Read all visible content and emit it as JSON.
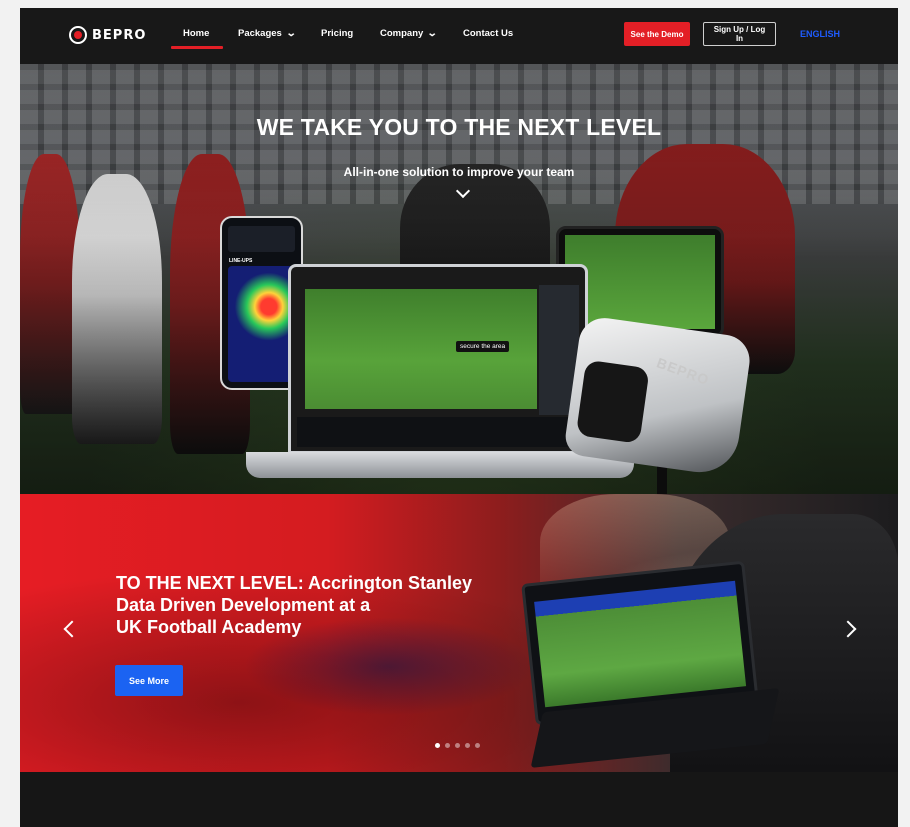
{
  "nav": {
    "logo_text": "BEPRO",
    "items": [
      {
        "label": "Home",
        "dropdown": false,
        "active": true
      },
      {
        "label": "Packages",
        "dropdown": true,
        "active": false
      },
      {
        "label": "Pricing",
        "dropdown": false,
        "active": false
      },
      {
        "label": "Company",
        "dropdown": true,
        "active": false
      },
      {
        "label": "Contact Us",
        "dropdown": false,
        "active": false
      }
    ],
    "demo_label": "See the Demo",
    "login_label": "Sign Up / Log In",
    "language": "ENGLISH"
  },
  "hero": {
    "title": "WE TAKE YOU TO THE NEXT LEVEL",
    "subtitle": "All-in-one solution to improve your team",
    "phone_label": "LINE-UPS",
    "callout": "secure the area",
    "camera_brand": "BEPRO"
  },
  "slider": {
    "title_lines": [
      "TO THE NEXT LEVEL: Accrington Stanley",
      "Data Driven Development at a",
      "UK Football Academy"
    ],
    "button_label": "See More",
    "dot_count": 5,
    "active_dot": 0
  },
  "colors": {
    "brand_red": "#e31f26",
    "accent_blue": "#1b63f2",
    "language_blue": "#1e5cff",
    "nav_bg": "#181818"
  }
}
